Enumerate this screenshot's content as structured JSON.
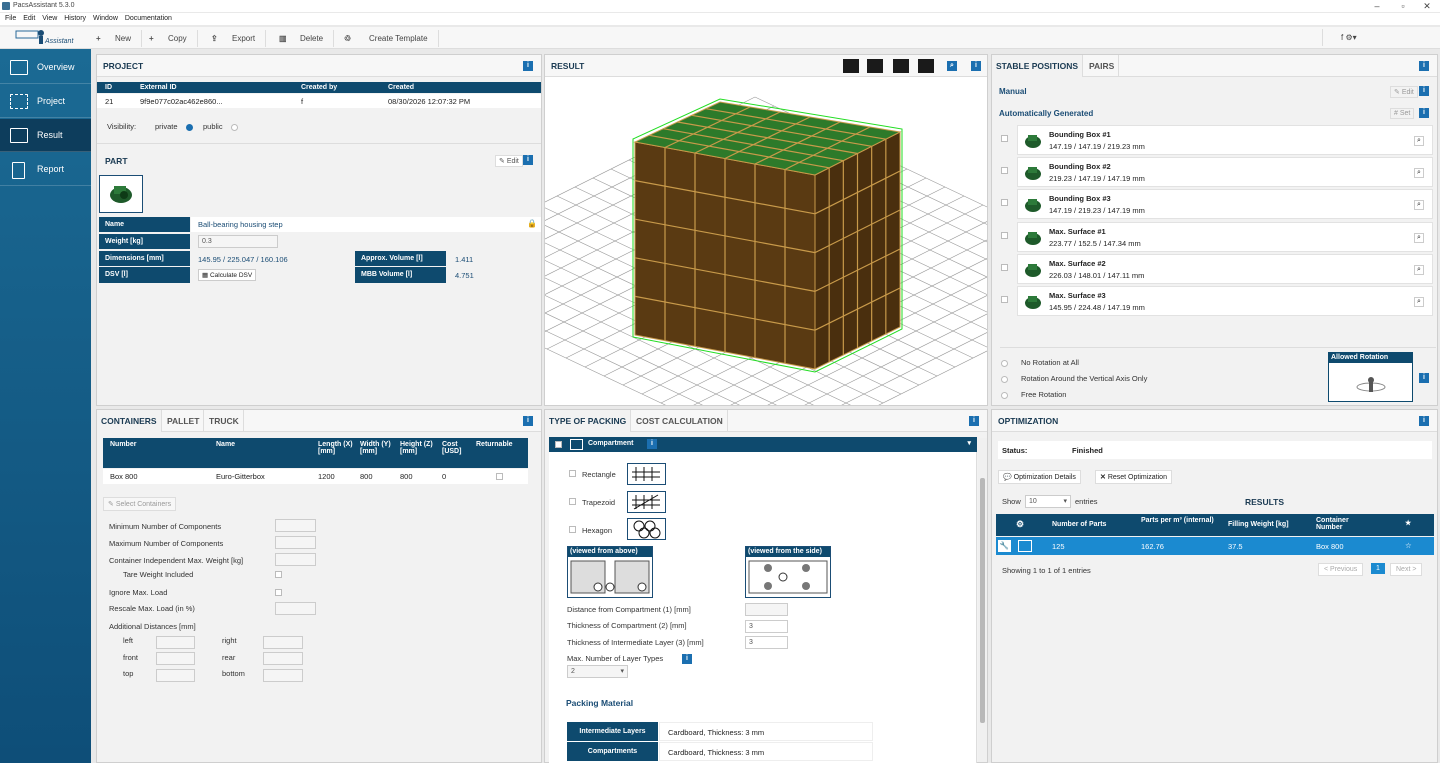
{
  "app": {
    "title": "PacsAssistant 5.3.0",
    "logo_text": "Assistant"
  },
  "menu": [
    "File",
    "Edit",
    "View",
    "History",
    "Window",
    "Documentation"
  ],
  "toolbar": {
    "new": "New",
    "copy": "Copy",
    "export": "Export",
    "delete": "Delete",
    "create_template": "Create Template",
    "user": "f"
  },
  "sidebar": {
    "items": [
      {
        "label": "Overview",
        "icon": "folder-icon"
      },
      {
        "label": "Project",
        "icon": "grid-icon"
      },
      {
        "label": "Result",
        "icon": "result-icon"
      },
      {
        "label": "Report",
        "icon": "document-icon"
      }
    ],
    "active": "Result"
  },
  "project": {
    "title": "PROJECT",
    "headers": [
      "ID",
      "External ID",
      "Created by",
      "Created"
    ],
    "row": [
      "21",
      "9f9e077c02ac462e860...",
      "f",
      "08/30/2026 12:07:32 PM"
    ],
    "visibility_label": "Visibility:",
    "private": "private",
    "public": "public"
  },
  "part": {
    "title": "PART",
    "edit": "Edit",
    "name_label": "Name",
    "name_value": "Ball-bearing housing step",
    "weight_label": "Weight [kg]",
    "weight_value": "0.3",
    "dimensions_label": "Dimensions [mm]",
    "dimensions_value": "145.95 / 225.047 / 160.106",
    "approx_volume_label": "Approx. Volume [l]",
    "approx_volume_value": "1.411",
    "dsv_label": "DSV [l]",
    "calc_dsv": "Calculate DSV",
    "mbb_label": "MBB Volume [l]",
    "mbb_value": "4.751"
  },
  "result": {
    "title": "RESULT"
  },
  "stable": {
    "tabs": [
      "STABLE POSITIONS",
      "PAIRS"
    ],
    "manual": "Manual",
    "edit": "Edit",
    "auto": "Automatically Generated",
    "set": "Set",
    "items": [
      {
        "title": "Bounding Box #1",
        "dims": "147.19 / 147.19 / 219.23 mm"
      },
      {
        "title": "Bounding Box #2",
        "dims": "219.23 / 147.19 / 147.19 mm"
      },
      {
        "title": "Bounding Box #3",
        "dims": "147.19 / 219.23 / 147.19 mm"
      },
      {
        "title": "Max. Surface #1",
        "dims": "223.77 / 152.5 / 147.34 mm"
      },
      {
        "title": "Max. Surface #2",
        "dims": "226.03 / 148.01 / 147.11 mm"
      },
      {
        "title": "Max. Surface #3",
        "dims": "145.95 / 224.48 / 147.19 mm"
      }
    ],
    "rotation": [
      "No Rotation at All",
      "Rotation Around the Vertical Axis Only",
      "Free Rotation"
    ],
    "allowed_rotation": "Allowed Rotation"
  },
  "containers": {
    "tabs": [
      "CONTAINERS",
      "PALLET",
      "TRUCK"
    ],
    "headers": [
      "Number",
      "Name",
      "Length (X) [mm]",
      "Width (Y) [mm]",
      "Height (Z) [mm]",
      "Cost [USD]",
      "Returnable"
    ],
    "row": [
      "Box 800",
      "Euro-Gitterbox",
      "1200",
      "800",
      "800",
      "0"
    ],
    "select": "Select Containers",
    "fields": [
      "Minimum Number of Components",
      "Maximum Number of Components",
      "Container Independent Max. Weight [kg]",
      "Tare Weight Included",
      "Ignore Max. Load",
      "Rescale Max. Load (in %)",
      "Additional Distances [mm]"
    ],
    "dist": [
      "left",
      "right",
      "front",
      "rear",
      "top",
      "bottom"
    ]
  },
  "packing": {
    "tabs": [
      "TYPE OF PACKING",
      "COST CALCULATION"
    ],
    "section": "Compartment",
    "types": [
      "Rectangle",
      "Trapezoid",
      "Hexagon"
    ],
    "viewed_above": "(viewed from above)",
    "viewed_side": "(viewed from the side)",
    "fields": [
      {
        "label": "Distance from Compartment (1) [mm]",
        "value": ""
      },
      {
        "label": "Thickness of Compartment (2) [mm]",
        "value": "3"
      },
      {
        "label": "Thickness of Intermediate Layer (3) [mm]",
        "value": "3"
      }
    ],
    "max_layers_label": "Max. Number of Layer Types",
    "max_layers_value": "2",
    "material_title": "Packing Material",
    "materials": [
      {
        "label": "Intermediate Layers",
        "value": "Cardboard, Thickness: 3 mm"
      },
      {
        "label": "Compartments",
        "value": "Cardboard, Thickness: 3 mm"
      }
    ]
  },
  "optimization": {
    "title": "OPTIMIZATION",
    "status_label": "Status:",
    "status_value": "Finished",
    "details": "Optimization Details",
    "reset": "Reset Optimization",
    "show": "Show",
    "show_value": "10",
    "entries": "entries",
    "results": "RESULTS",
    "headers": [
      "Number of Parts",
      "Parts per m³ (internal)",
      "Filling Weight [kg]",
      "Container Number"
    ],
    "row": [
      "125",
      "162.76",
      "37.5",
      "Box 800"
    ],
    "showing": "Showing 1 to 1 of 1 entries",
    "previous": "< Previous",
    "page": "1",
    "next": "Next >"
  }
}
